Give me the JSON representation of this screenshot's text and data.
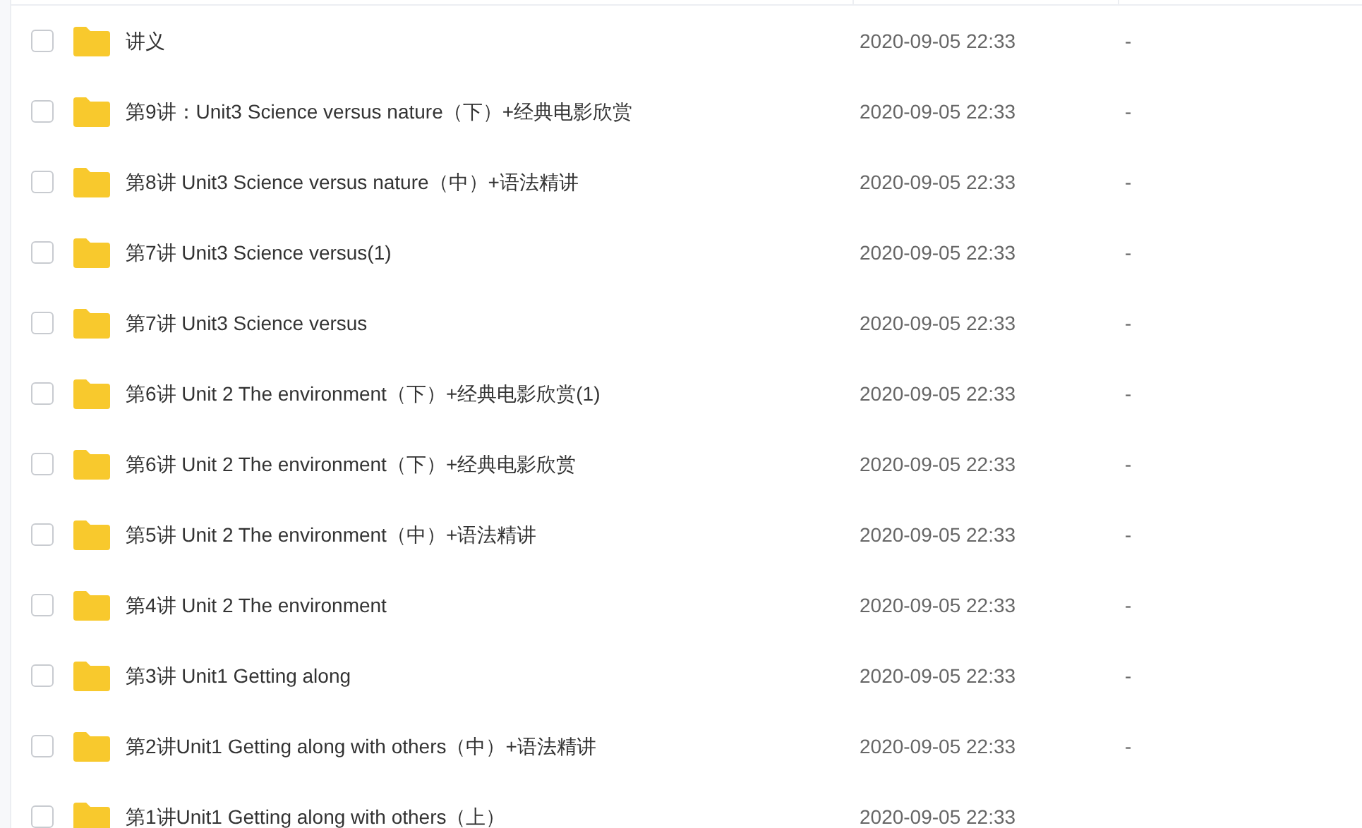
{
  "rows": [
    {
      "name": "讲义",
      "modified": "2020-09-05 22:33",
      "size": "-",
      "checked": false
    },
    {
      "name": "第9讲：Unit3 Science versus nature（下）+经典电影欣赏",
      "modified": "2020-09-05 22:33",
      "size": "-",
      "checked": false
    },
    {
      "name": "第8讲 Unit3 Science versus nature（中）+语法精讲",
      "modified": "2020-09-05 22:33",
      "size": "-",
      "checked": false
    },
    {
      "name": "第7讲 Unit3 Science versus(1)",
      "modified": "2020-09-05 22:33",
      "size": "-",
      "checked": false
    },
    {
      "name": "第7讲 Unit3 Science versus",
      "modified": "2020-09-05 22:33",
      "size": "-",
      "checked": false
    },
    {
      "name": "第6讲 Unit 2 The environment（下）+经典电影欣赏(1)",
      "modified": "2020-09-05 22:33",
      "size": "-",
      "checked": false
    },
    {
      "name": "第6讲 Unit 2 The environment（下）+经典电影欣赏",
      "modified": "2020-09-05 22:33",
      "size": "-",
      "checked": false
    },
    {
      "name": "第5讲 Unit 2 The environment（中）+语法精讲",
      "modified": "2020-09-05 22:33",
      "size": "-",
      "checked": false
    },
    {
      "name": "第4讲 Unit 2 The environment",
      "modified": "2020-09-05 22:33",
      "size": "-",
      "checked": false
    },
    {
      "name": "第3讲 Unit1 Getting along",
      "modified": "2020-09-05 22:33",
      "size": "-",
      "checked": false
    },
    {
      "name": "第2讲Unit1 Getting along with others（中）+语法精讲",
      "modified": "2020-09-05 22:33",
      "size": "-",
      "checked": false
    },
    {
      "name": "第1讲Unit1 Getting along with others（上）",
      "modified": "2020-09-05 22:33",
      "checked": false
    }
  ]
}
